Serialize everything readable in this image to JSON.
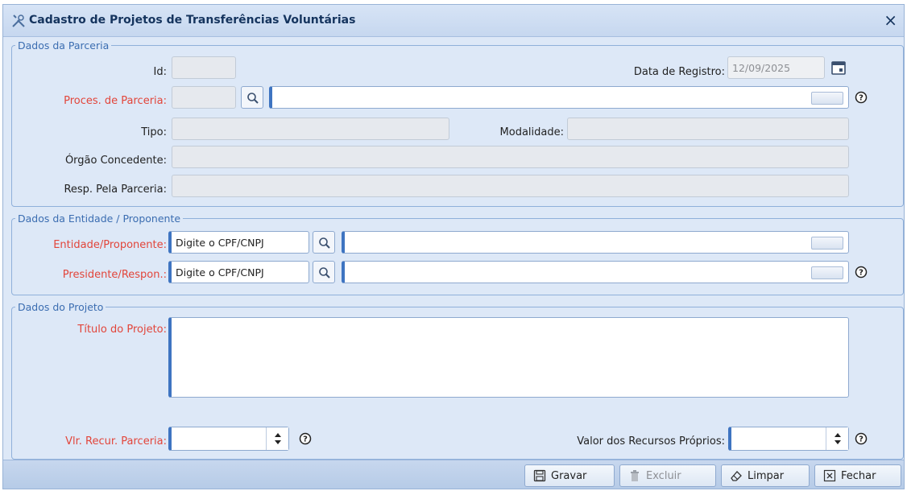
{
  "window": {
    "title": "Cadastro de Projetos de Transferências Voluntárias",
    "close": "×"
  },
  "parceria": {
    "legend": "Dados da Parceria",
    "id_label": "Id:",
    "id_value": "",
    "data_registro_label": "Data de Registro:",
    "data_registro_value": "12/09/2025",
    "proces_label": "Proces. de Parceria:",
    "proces_code": "",
    "proces_desc": "",
    "tipo_label": "Tipo:",
    "tipo_value": "",
    "modalidade_label": "Modalidade:",
    "modalidade_value": "",
    "orgao_label": "Órgão Concedente:",
    "orgao_value": "",
    "resp_label": "Resp. Pela Parceria:",
    "resp_value": ""
  },
  "entidade": {
    "legend": "Dados da Entidade / Proponente",
    "entidade_label": "Entidade/Proponente:",
    "entidade_placeholder": "Digite o CPF/CNPJ",
    "entidade_nome": "",
    "presidente_label": "Presidente/Respon.:",
    "presidente_placeholder": "Digite o CPF/CNPJ",
    "presidente_nome": ""
  },
  "projeto": {
    "legend": "Dados do Projeto",
    "titulo_label": "Título do Projeto:",
    "titulo_value": "",
    "vlr_label": "Vlr. Recur. Parceria:",
    "vlr_value": "",
    "proprios_label": "Valor dos Recursos Próprios:",
    "proprios_value": ""
  },
  "toolbar": {
    "gravar": "Gravar",
    "excluir": "Excluir",
    "limpar": "Limpar",
    "fechar": "Fechar"
  },
  "colors": {
    "required": "#e2453a",
    "legend": "#3b6db1",
    "accent": "#3e74c1",
    "panel": "#dde8f7"
  }
}
